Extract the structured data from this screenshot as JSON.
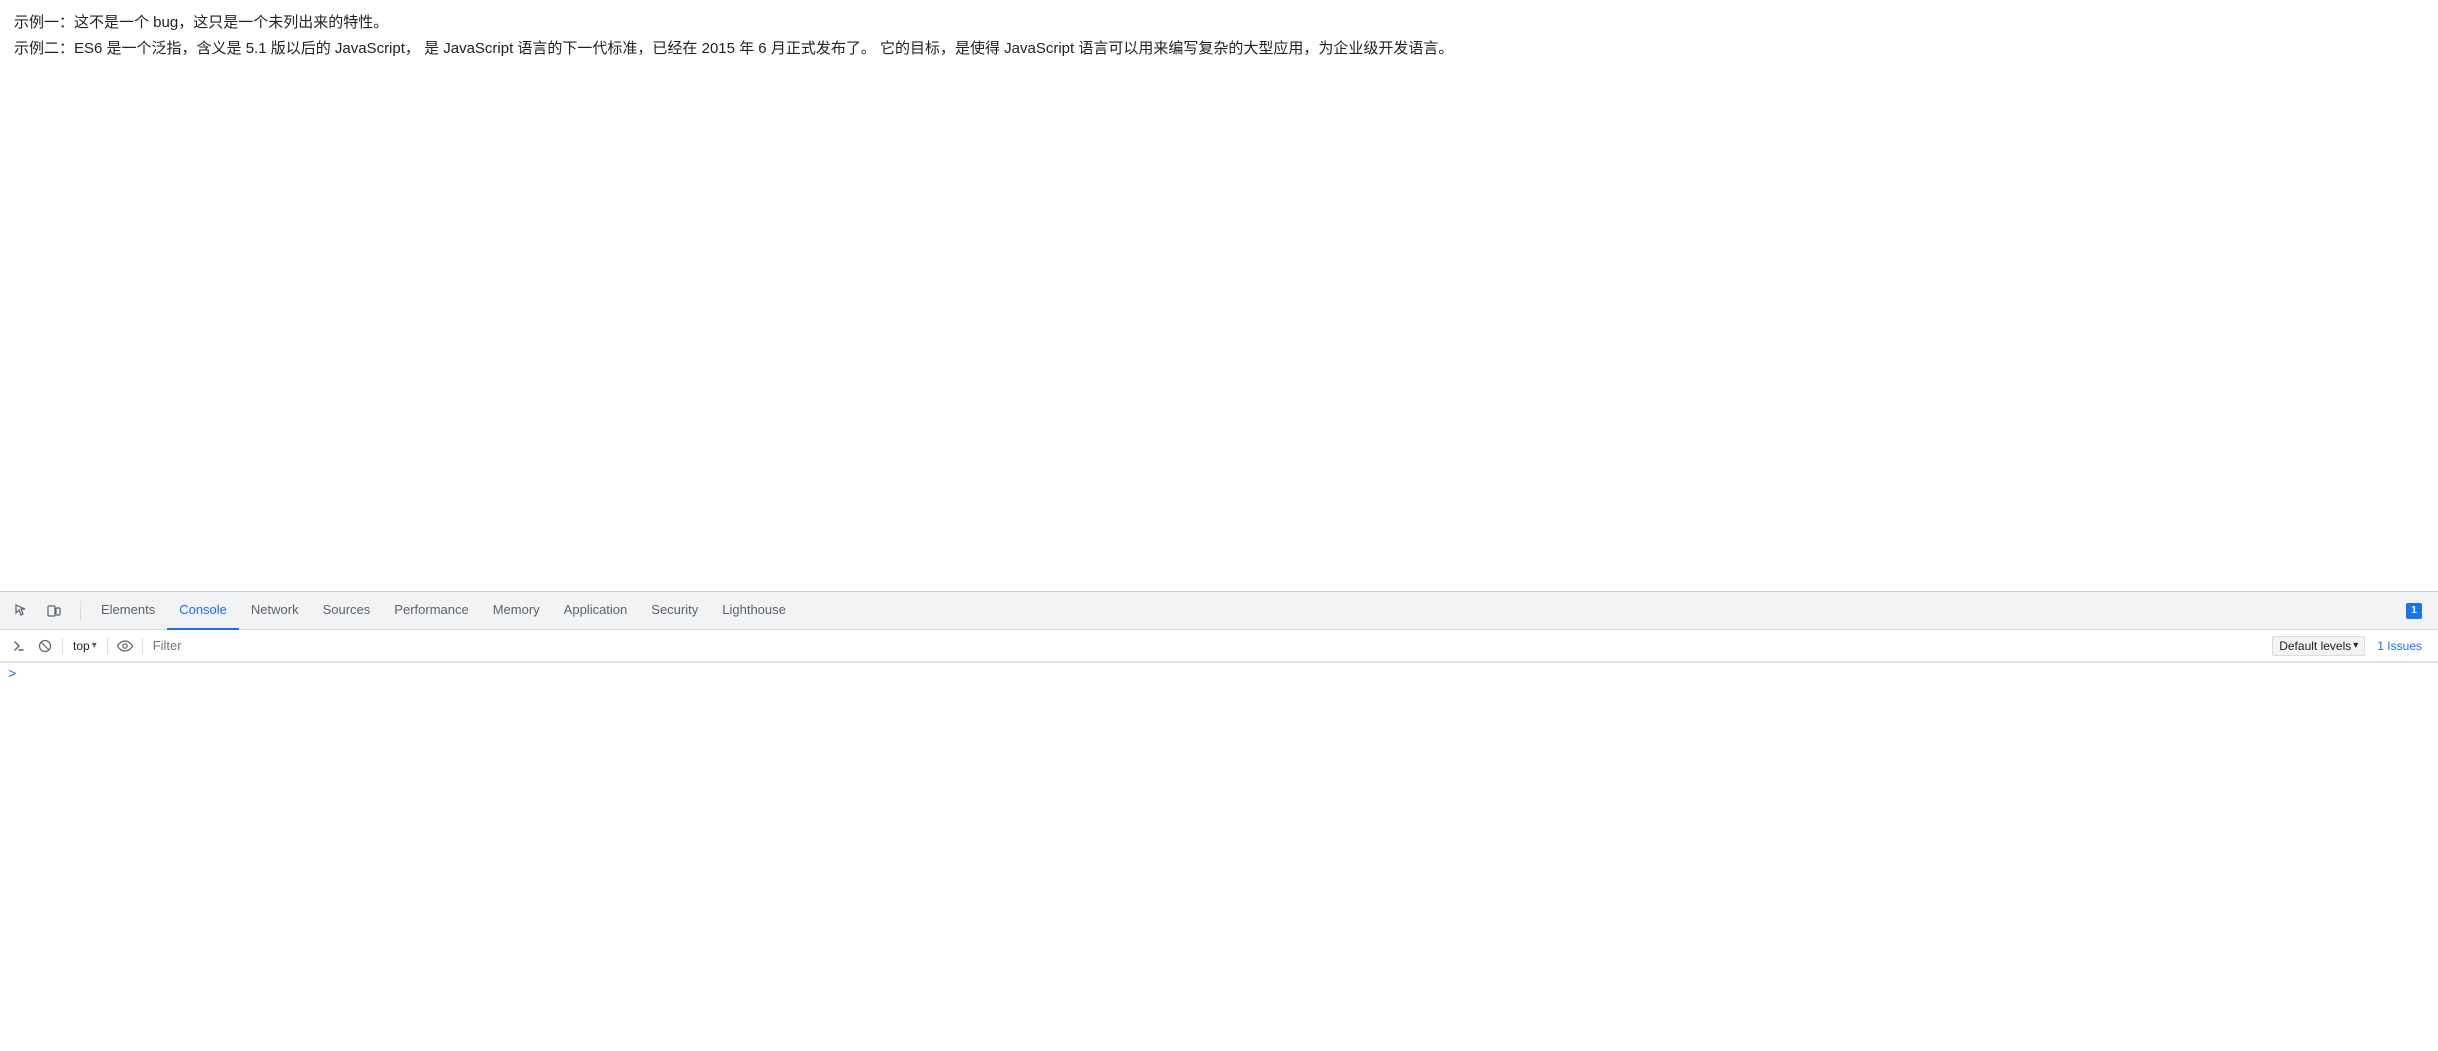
{
  "page": {
    "content": {
      "line1": "示例一：这不是一个 bug，这只是一个未列出来的特性。",
      "line2": "示例二：ES6 是一个泛指，含义是 5.1 版以后的 JavaScript， 是 JavaScript 语言的下一代标准，已经在 2015 年 6 月正式发布了。 它的目标，是使得 JavaScript 语言可以用来编写复杂的大型应用，为企业级开发语言。"
    }
  },
  "devtools": {
    "tabs": [
      {
        "id": "elements",
        "label": "Elements",
        "active": false
      },
      {
        "id": "console",
        "label": "Console",
        "active": true
      },
      {
        "id": "network",
        "label": "Network",
        "active": false
      },
      {
        "id": "sources",
        "label": "Sources",
        "active": false
      },
      {
        "id": "performance",
        "label": "Performance",
        "active": false
      },
      {
        "id": "memory",
        "label": "Memory",
        "active": false
      },
      {
        "id": "application",
        "label": "Application",
        "active": false
      },
      {
        "id": "security",
        "label": "Security",
        "active": false
      },
      {
        "id": "lighthouse",
        "label": "Lighthouse",
        "active": false
      }
    ],
    "toolbar": {
      "top_label": "top",
      "filter_placeholder": "Filter",
      "default_levels_label": "Default levels",
      "issues_label": "1 Issues"
    },
    "issues_badge": {
      "count": "1",
      "label": "1"
    },
    "console": {
      "prompt_symbol": ">"
    }
  }
}
